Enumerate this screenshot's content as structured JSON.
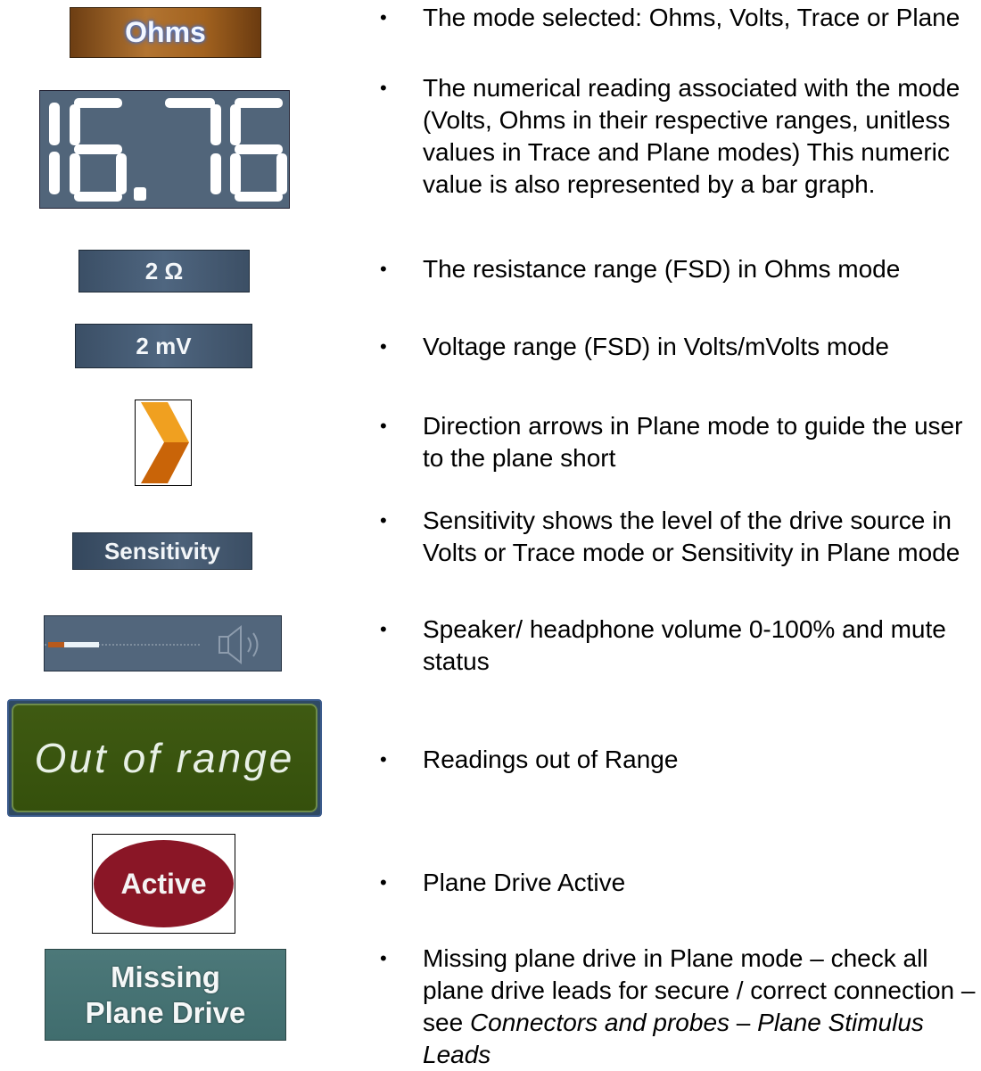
{
  "icons": {
    "ohms_label": "Ohms",
    "reading_value": "16.76",
    "ohm_range": "2 Ω",
    "mv_range": "2 mV",
    "sensitivity_label": "Sensitivity",
    "out_of_range_label": "Out of range",
    "active_label": "Active",
    "missing_line1": "Missing",
    "missing_line2": "Plane Drive",
    "arrow_icon": "chevron-right-icon",
    "speaker_icon": "speaker-icon",
    "volume_level_fraction": 0.35
  },
  "bullets": {
    "mode": "The mode selected: Ohms, Volts, Trace or Plane",
    "reading": "The numerical reading associated with the mode (Volts, Ohms in their respective ranges, unitless values in Trace and Plane modes) This numeric value is also represented by a bar graph.",
    "resistance": "The resistance range (FSD) in Ohms mode",
    "voltage": "Voltage range (FSD) in Volts/mVolts mode",
    "direction": "Direction arrows in Plane mode to guide the user to the plane short",
    "sensitivity": "Sensitivity shows the level of the drive source in Volts or Trace mode or Sensitivity in Plane mode",
    "volume": "Speaker/ headphone volume 0-100% and mute status",
    "out_of_range": "Readings out of Range",
    "active": "Plane Drive Active",
    "missing_prefix": "Missing plane drive in Plane mode – check all plane drive leads for secure / correct connection – see ",
    "missing_ref1": "Connectors and probes",
    "missing_sep": " – ",
    "missing_ref2": "Plane Stimulus Leads"
  },
  "bullet_glyph": "•",
  "colors": {
    "ohms_badge": "#a2621f",
    "panel_blue": "#51657a",
    "out_of_range_green": "#3f5a12",
    "active_red": "#8a1626",
    "missing_teal": "#4c7879",
    "arrow_orange": "#e8880e"
  }
}
